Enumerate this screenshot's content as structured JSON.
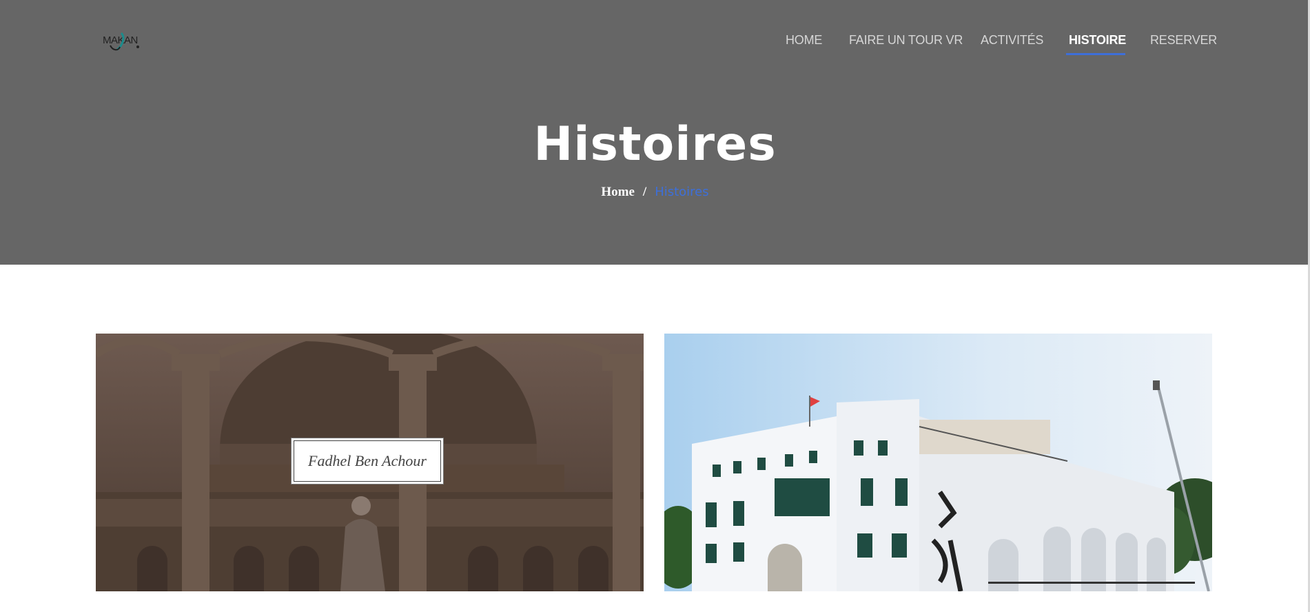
{
  "brand": {
    "logo_text": "MAKAN"
  },
  "nav": {
    "items": [
      {
        "label": "HOME"
      },
      {
        "label": "FAIRE UN TOUR VR"
      },
      {
        "label": "ACTIVITÉS"
      },
      {
        "label": "HISTOIRE",
        "active": true
      },
      {
        "label": "RESERVER"
      }
    ],
    "accent_color": "#3d6fd9"
  },
  "hero": {
    "title": "Histoires",
    "breadcrumb": {
      "home": "Home",
      "separator": "/",
      "current": "Histoires"
    },
    "background_color": "#666666"
  },
  "cards": [
    {
      "caption": "Fadhel Ben Achour",
      "image": "sepia-mosque-dome-photo"
    },
    {
      "caption": "",
      "image": "white-building-makan-photo"
    }
  ]
}
